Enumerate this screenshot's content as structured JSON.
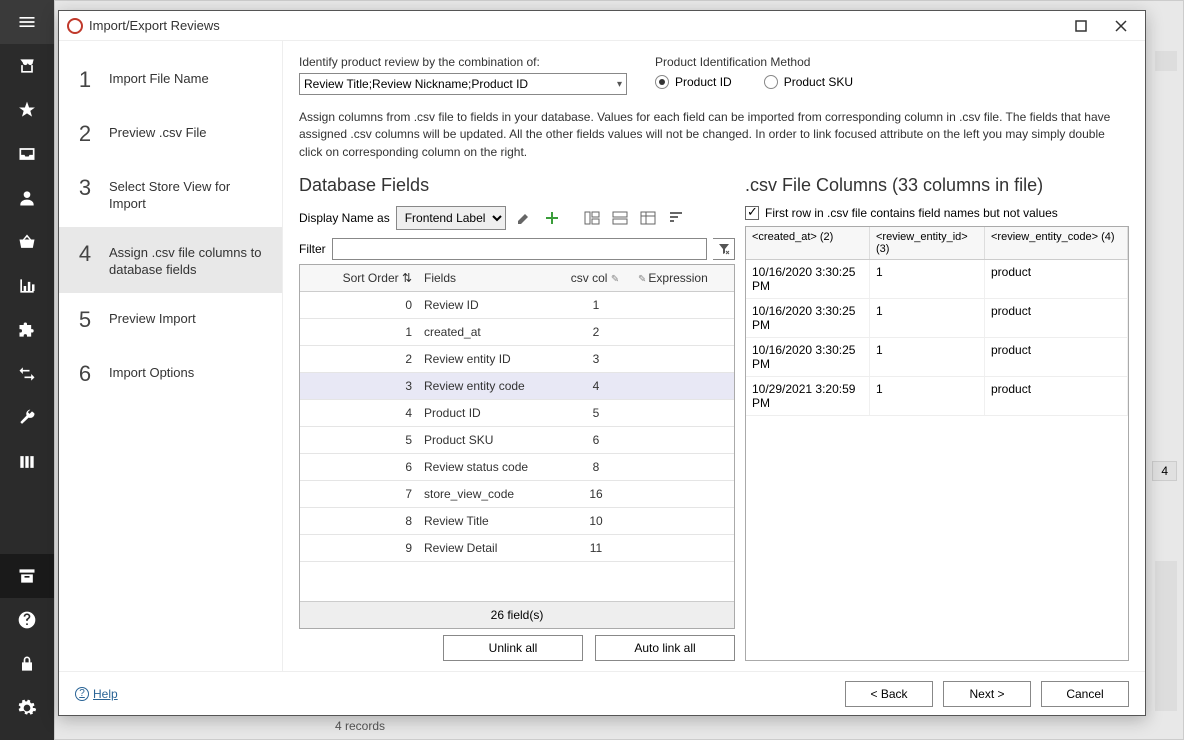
{
  "bg": {
    "records": "4 records",
    "badge": "4"
  },
  "dialog": {
    "title": "Import/Export Reviews",
    "steps": [
      "Import File Name",
      "Preview .csv File",
      "Select Store View for Import",
      "Assign .csv file columns to database fields",
      "Preview Import",
      "Import Options"
    ],
    "active_step": 3,
    "identify_label": "Identify product review by the combination of:",
    "identify_combo": "Review Title;Review Nickname;Product ID",
    "pim_label": "Product Identification Method",
    "pim_options": [
      "Product ID",
      "Product SKU"
    ],
    "pim_selected": 0,
    "desc": "Assign columns from .csv file to fields in your database. Values for each field can be imported from corresponding column in .csv file. The fields that have assigned .csv columns will be updated. All the other fields values will not be changed. In order to link focused attribute on the left you may simply double click on corresponding column on the right.",
    "db_title": "Database Fields",
    "display_label": "Display Name as",
    "display_value": "Frontend Label",
    "filter_label": "Filter",
    "grid_headers": {
      "sort": "Sort Order",
      "fields": "Fields",
      "csv": "csv col",
      "expr": "Expression"
    },
    "grid_rows": [
      {
        "sort": "0",
        "field": "Review ID",
        "csv": "1"
      },
      {
        "sort": "1",
        "field": "created_at",
        "csv": "2"
      },
      {
        "sort": "2",
        "field": "Review entity ID",
        "csv": "3"
      },
      {
        "sort": "3",
        "field": "Review entity code",
        "csv": "4"
      },
      {
        "sort": "4",
        "field": "Product ID",
        "csv": "5"
      },
      {
        "sort": "5",
        "field": "Product SKU",
        "csv": "6"
      },
      {
        "sort": "6",
        "field": "Review status code",
        "csv": "8"
      },
      {
        "sort": "7",
        "field": "store_view_code",
        "csv": "16"
      },
      {
        "sort": "8",
        "field": "Review Title",
        "csv": "10"
      },
      {
        "sort": "9",
        "field": "Review Detail",
        "csv": "11"
      }
    ],
    "grid_selected": 3,
    "grid_footer": "26 field(s)",
    "unlink": "Unlink all",
    "autolink": "Auto link all",
    "csv_title": ".csv File Columns (33 columns in file)",
    "firstrow_check": "First row in .csv file contains field names but not values",
    "firstrow_checked": true,
    "csv_headers": [
      "<created_at>  (2)",
      "<review_entity_id>  (3)",
      "<review_entity_code>  (4)"
    ],
    "csv_rows": [
      {
        "c1": "10/16/2020 3:30:25 PM",
        "c2": "1",
        "c3": "product"
      },
      {
        "c1": "10/16/2020 3:30:25 PM",
        "c2": "1",
        "c3": "product"
      },
      {
        "c1": "10/16/2020 3:30:25 PM",
        "c2": "1",
        "c3": "product"
      },
      {
        "c1": "10/29/2021 3:20:59 PM",
        "c2": "1",
        "c3": "product"
      }
    ],
    "help": "Help",
    "back": "< Back",
    "next": "Next >",
    "cancel": "Cancel"
  }
}
